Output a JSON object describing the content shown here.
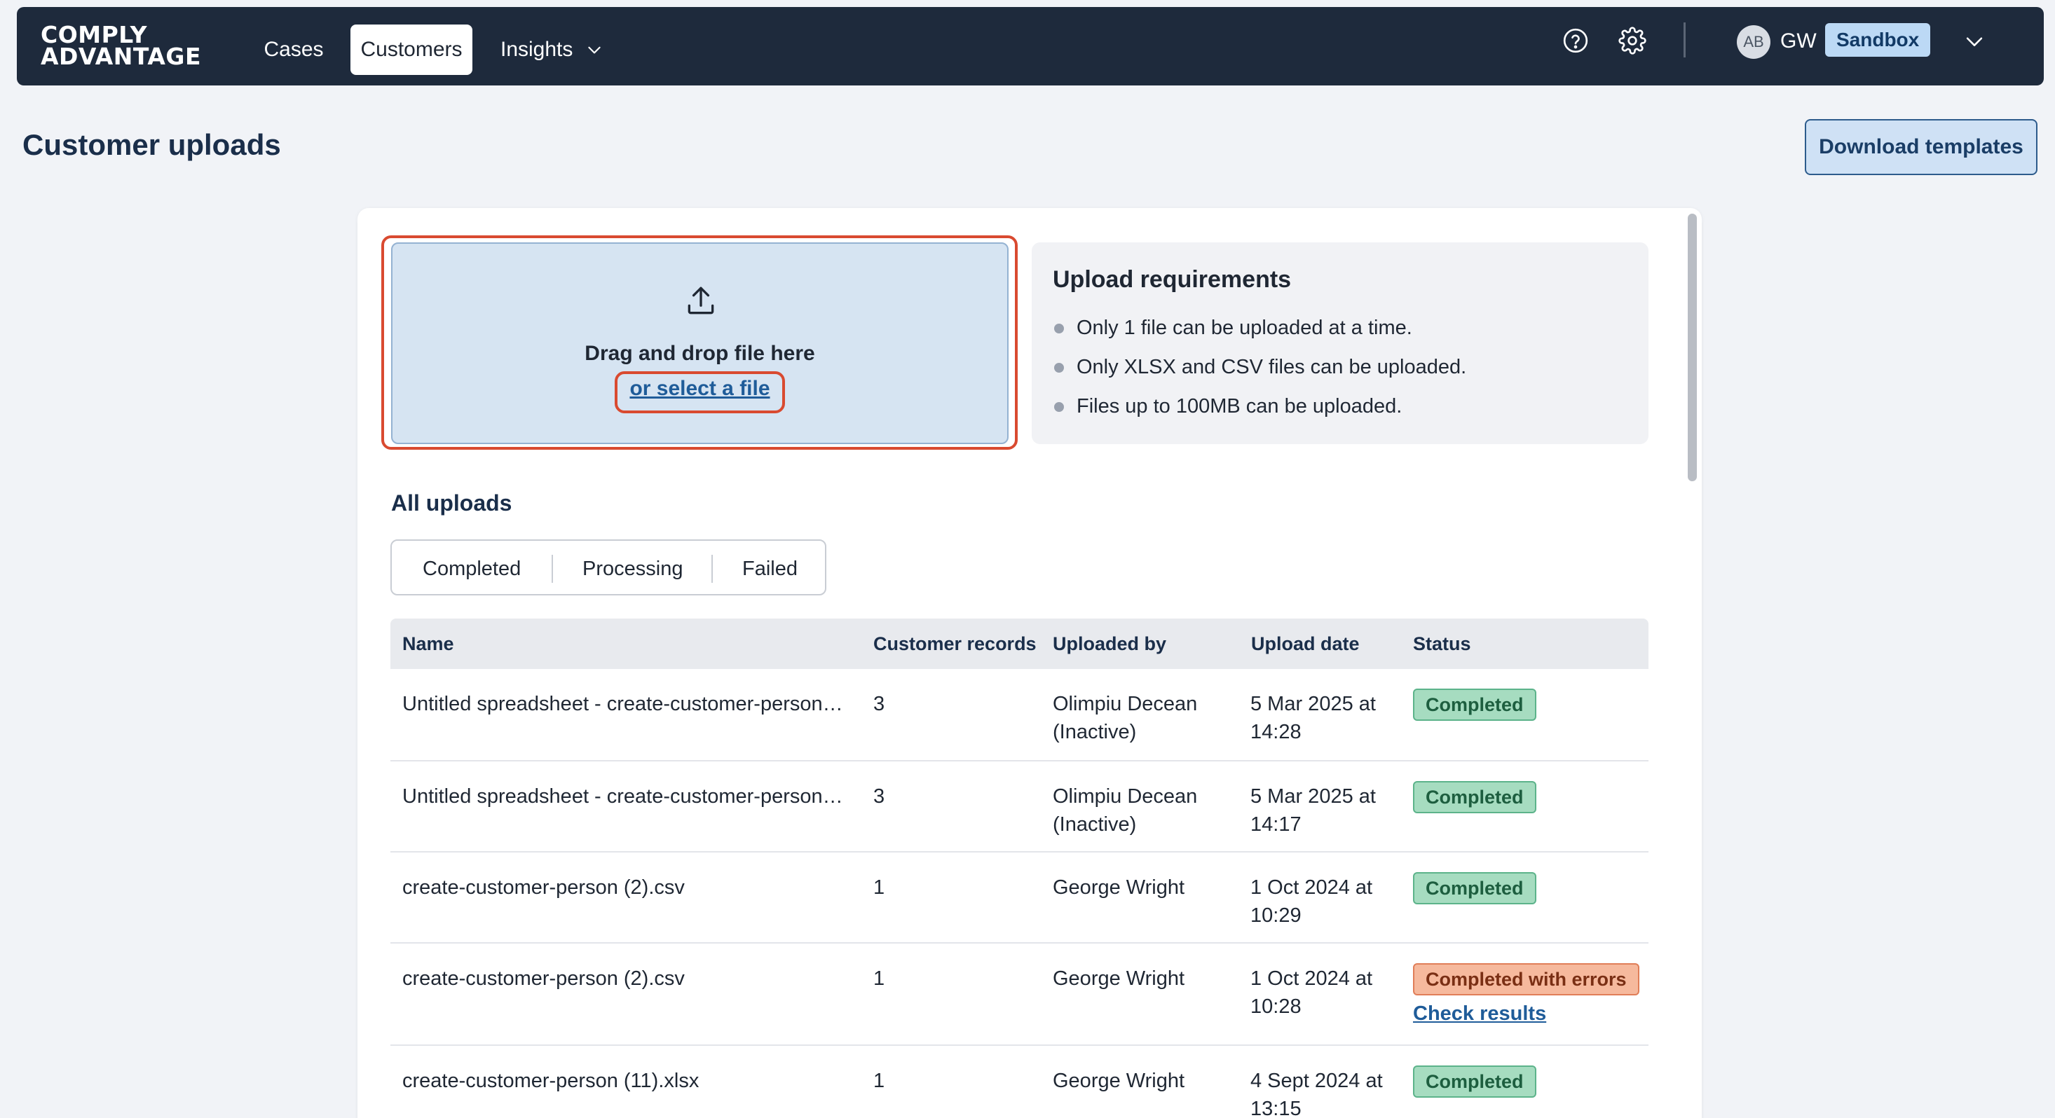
{
  "nav": {
    "logo_line1": "COMPLY",
    "logo_line2": "ADVANTAGE",
    "links": [
      "Cases",
      "Customers",
      "Insights"
    ],
    "active_link": "Customers",
    "user_avatar": "AB",
    "user_initials": "GW",
    "environment": "Sandbox"
  },
  "page": {
    "title": "Customer uploads",
    "download_button": "Download templates"
  },
  "dropzone": {
    "title": "Drag and drop file here",
    "select_link": "or select a file"
  },
  "requirements": {
    "title": "Upload requirements",
    "items": [
      "Only 1 file can be uploaded at a time.",
      "Only XLSX and CSV files can be uploaded.",
      "Files up to 100MB can be uploaded."
    ]
  },
  "uploads": {
    "title": "All uploads",
    "filters": [
      "Completed",
      "Processing",
      "Failed"
    ],
    "columns": [
      "Name",
      "Customer records",
      "Uploaded by",
      "Upload date",
      "Status"
    ],
    "rows": [
      {
        "name": "Untitled spreadsheet - create-customer-person…",
        "records": "3",
        "by_line1": "Olimpiu Decean",
        "by_line2": "(Inactive)",
        "date_line1": "5 Mar 2025 at",
        "date_line2": "14:28",
        "status": "Completed"
      },
      {
        "name": "Untitled spreadsheet - create-customer-person…",
        "records": "3",
        "by_line1": "Olimpiu Decean",
        "by_line2": "(Inactive)",
        "date_line1": "5 Mar 2025 at",
        "date_line2": "14:17",
        "status": "Completed"
      },
      {
        "name": "create-customer-person (2).csv",
        "records": "1",
        "by_line1": "George Wright",
        "by_line2": "",
        "date_line1": "1 Oct 2024 at",
        "date_line2": "10:29",
        "status": "Completed"
      },
      {
        "name": "create-customer-person (2).csv",
        "records": "1",
        "by_line1": "George Wright",
        "by_line2": "",
        "date_line1": "1 Oct 2024 at",
        "date_line2": "10:28",
        "status": "Completed with errors",
        "action": "Check results"
      },
      {
        "name": "create-customer-person (11).xlsx",
        "records": "1",
        "by_line1": "George Wright",
        "by_line2": "",
        "date_line1": "4 Sept 2024 at",
        "date_line2": "13:15",
        "status": "Completed"
      }
    ]
  },
  "colors": {
    "nav_bg": "#1e2a3c",
    "accent_link": "#1f5c99",
    "highlight_outline": "#d94a30",
    "status_ok": "#a6dcc0",
    "status_error": "#f6b99d"
  },
  "icons": [
    "help-icon",
    "gear-icon",
    "chevron-down-icon",
    "upload-icon"
  ]
}
